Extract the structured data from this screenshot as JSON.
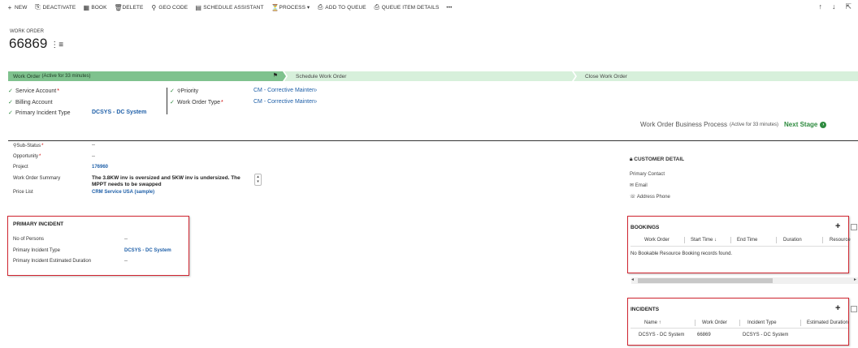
{
  "toolbar": {
    "items": [
      {
        "icon": "plus-icon",
        "glyph": "+",
        "label": "NEW"
      },
      {
        "icon": "deactivate-icon",
        "glyph": "⎘",
        "label": "DEACTIVATE"
      },
      {
        "icon": "book-icon",
        "glyph": "▦",
        "label": "BOOK"
      },
      {
        "icon": "delete-icon",
        "glyph": "🗑",
        "label": "DELETE"
      },
      {
        "icon": "geo-pin-icon",
        "glyph": "⚲",
        "label": "GEO CODE"
      },
      {
        "icon": "schedule-icon",
        "glyph": "▤",
        "label": "SCHEDULE ASSISTANT"
      },
      {
        "icon": "process-icon",
        "glyph": "⏳",
        "label": "PROCESS ▾"
      },
      {
        "icon": "queue-icon",
        "glyph": "⎙",
        "label": "ADD TO QUEUE"
      },
      {
        "icon": "queue-details-icon",
        "glyph": "⎙",
        "label": "QUEUE ITEM DETAILS"
      },
      {
        "icon": "more-icon",
        "glyph": "",
        "label": "•••"
      }
    ],
    "nav": {
      "up": "↑",
      "down": "↓",
      "expand": "⇱"
    }
  },
  "header": {
    "entity": "WORK ORDER",
    "title": "66869",
    "menu_glyph": "⋮≡"
  },
  "process": {
    "stages": [
      {
        "name": "Work Order",
        "meta": "(Active for 33 minutes)"
      },
      {
        "name": "Schedule Work Order"
      },
      {
        "name": "Close Work Order"
      }
    ],
    "flag": "⚑",
    "fields_left": [
      {
        "label": "Service Account",
        "required": "*"
      },
      {
        "label": "Billing Account"
      },
      {
        "label": "Primary Incident Type",
        "value": "DCSYS - DC System"
      }
    ],
    "fields_right": [
      {
        "label": "Priority",
        "value": "CM - Corrective Mainten›"
      },
      {
        "label": "Work Order Type",
        "required": "*",
        "value": "CM - Corrective Mainten›"
      }
    ],
    "bpf_name": "Work Order Business Process",
    "bpf_meta": "(Active for 33 minutes)",
    "next_stage": "Next Stage"
  },
  "main_fields": [
    {
      "label": "Sub-Status",
      "required": "*",
      "value": "--",
      "bold": false
    },
    {
      "label": "Opportunity",
      "required": "*",
      "value": "--",
      "bold": false
    },
    {
      "label": "Project",
      "value": "176960",
      "bold": true,
      "link": true
    },
    {
      "label": "Work Order Summary",
      "value": ""
    },
    {
      "label": "Price List",
      "value": "CRM Service USA (sample)",
      "bold": true,
      "link": true
    }
  ],
  "summary_text": "The 3.8KW inv is oversized and 5KW inv is undersized. The MPPT needs to be swapped",
  "customer": {
    "heading": "CUSTOMER DETAIL",
    "primary_contact": "Primary Contact",
    "email": "Email",
    "address_phone": "Address Phone"
  },
  "primary_incident": {
    "title": "PRIMARY INCIDENT",
    "rows": [
      {
        "label": "No of Persons",
        "value": "--"
      },
      {
        "label": "Primary Incident Type",
        "value": "DCSYS - DC System"
      },
      {
        "label": "Primary Incident Estimated Duration",
        "value": "--"
      }
    ]
  },
  "bookings": {
    "title": "BOOKINGS",
    "columns": [
      "Work Order",
      "Start Time ↓",
      "End Time",
      "Duration",
      "Resource"
    ],
    "empty": "No Bookable Resource Booking records found.",
    "add": "+"
  },
  "incidents": {
    "title": "INCIDENTS",
    "columns": [
      "Name ↑",
      "Work Order",
      "Incident Type",
      "Estimated Duration"
    ],
    "rows": [
      {
        "name": "DCSYS - DC System",
        "work_order": "66869",
        "type": "DCSYS - DC System"
      }
    ],
    "add": "+"
  }
}
